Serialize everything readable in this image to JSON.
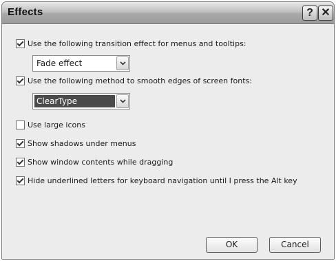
{
  "window": {
    "title": "Effects"
  },
  "titlebar": {
    "help_glyph": "?",
    "close_glyph": "✕"
  },
  "options": {
    "transition": {
      "label": "Use the following transition effect for menus and tooltips:",
      "checked": true
    },
    "transition_select": {
      "value": "Fade effect"
    },
    "smoothing": {
      "label": "Use the following method to smooth edges of screen fonts:",
      "checked": true
    },
    "smoothing_select": {
      "value": "ClearType"
    },
    "large_icons": {
      "label": "Use large icons",
      "checked": false
    },
    "shadows": {
      "label": "Show shadows under menus",
      "checked": true
    },
    "drag_contents": {
      "label": "Show window contents while dragging",
      "checked": true
    },
    "hide_underlines": {
      "label": "Hide underlined letters for keyboard navigation until I press the Alt key",
      "checked": true
    }
  },
  "buttons": {
    "ok": "OK",
    "cancel": "Cancel"
  }
}
